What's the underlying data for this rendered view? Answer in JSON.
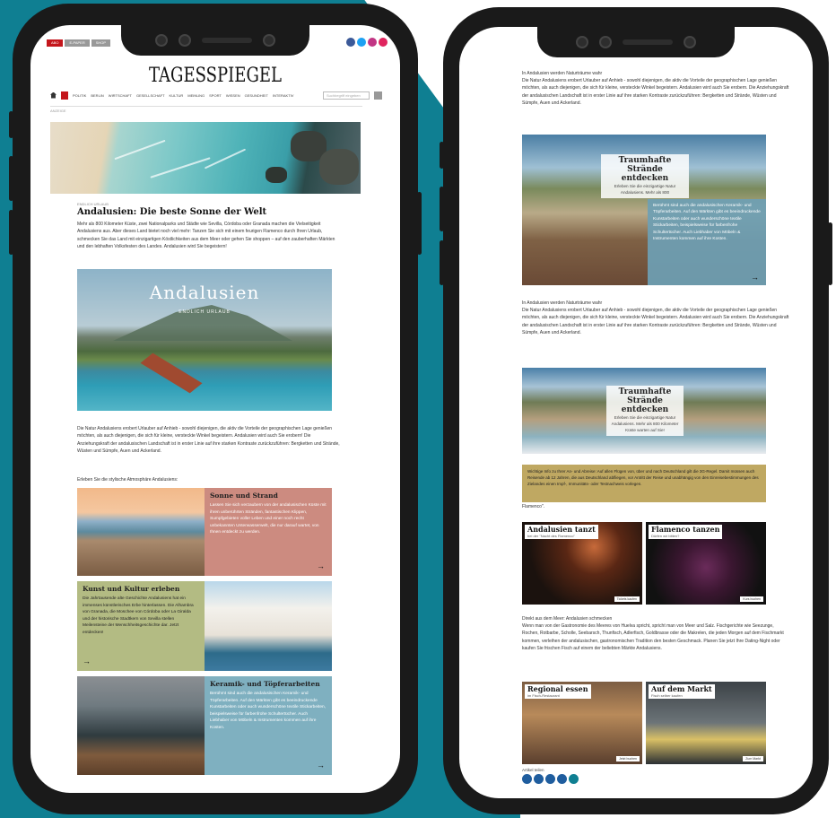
{
  "colors": {
    "teal": "#0f7f92",
    "red": "#c4161c",
    "card_rose": "#cc8b80",
    "card_olive": "#b3bb83",
    "card_blue": "#7fb0c0",
    "olive_box": "#bfa862",
    "phone_frame": "#1a1a1a"
  },
  "phone1": {
    "masthead": "TAGESSPIEGEL",
    "nav_items": [
      "POLITIK",
      "BERLIN",
      "WIRTSCHAFT",
      "GESELLSCHAFT",
      "KULTUR",
      "MEINUNG",
      "SPORT",
      "WISSEN",
      "GESUNDHEIT",
      "INTERAKTIV"
    ],
    "search_placeholder": "Suchbegriff eingeben",
    "breadcrumb": "ANZEIGE",
    "kicker": "ENDLICH URLAUB",
    "headline": "Andalusien: Die beste Sonne der Welt",
    "intro": "Mehr als 800 Kilometer Küste, zwei Nationalparks und Städte wie Sevilla, Córdoba oder Granada machen die Vielseitigkeit Andalusiens aus. Aber dieses Land bietet noch viel mehr: Tanzen Sie sich mit einem feurigen Flamenco durch Ihren Urlaub, schmecken Sie das Land mit einzigartigen Köstlichkeiten aus dem Meer oder gehen Sie shoppen – auf den zauberhaften Märkten und den lebhaften Volksfesten des Landes. Andalusien wird Sie begeistern!",
    "hero_title": "Andalusien",
    "hero_subtitle": "ENDLICH URLAUB",
    "body": "Die Natur Andalusiens erobert Urlauber auf Anhieb - sowohl diejenigen, die aktiv die Vorteile der geographischen Lage genießen möchten, als auch diejenigen, die sich für kleine, versteckte Winkel begeistern. Andalusien wird auch Sie erobern! Die Anziehungskraft der andalusischen Landschaft ist in erster Linie auf ihre starken Kontraste zurückzuführen: Bergketten und Strände, Wüsten und Sümpfe, Auen und Ackerland.",
    "lead_in": "Erleben Sie die stylische Atmosphäre Andalusiens:",
    "cards": [
      {
        "title": "Sonne und Strand",
        "text": "Lassen Sie sich verzaubern von der andalusischen Küste mit ihren unberührten Stränden, fantastischen Klippen, Sumpfgebieten voller Leben und einer noch recht unbekannten Unterwasserwelt, die nur darauf wartet, von Ihnen entdeckt zu werden.",
        "arrow": "→"
      },
      {
        "title": "Kunst und Kultur erleben",
        "text": "Die Jahrtausende alte Geschichte Andalusiens hat ein immenses künstlerisches Erbe hinterlassen. Die Alhambra von Granada, die Moschee von Córdoba oder La Giralda und der historische Stadtkern von Sevilla stellen Meilensteine der Menschheitsgeschichte dar. Jetzt entdecken!",
        "arrow": "→"
      },
      {
        "title": "Keramik- und Töpferarbeiten",
        "text": "Berühmt sind auch die andalusischen Keramik- und Töpferarbeiten. Auf den Märkten gibt es beeindruckende Kunstarbeiten oder auch wunderschöne textile Stickarbeiten, beispielsweise für farbenfrohe Schultertücher. Auch Liebhaber von Möbeln & Instrumenten kommen auf ihre Kosten.",
        "arrow": "→"
      }
    ]
  },
  "phone2": {
    "para_a_title": "In Andalusien werden Naturträume wahr",
    "para_a": "Die Natur Andalusiens erobert Urlauber auf Anhieb - sowohl diejenigen, die aktiv die Vorteile der geographischen Lage genießen möchten, als auch diejenigen, die sich für kleine, versteckte Winkel begeistern. Andalusien wird auch Sie erobern. Die Anziehungskraft der andalusischen Landschaft ist in erster Linie auf ihre starken Kontraste zurückzuführen: Bergketten und Strände, Wüsten und Sümpfe, Auen und Ackerland.",
    "card1_title": "Traumhafte Strände entdecken",
    "card1_sub": "Erleben Sie die einzigartige Natur Andalusiens. Mehr als 800",
    "card1_box": "Berühmt sind auch die andalusischen Keramik- und Töpferarbeiten. Auf den Märkten gibt es beeindruckende Kunstarbeiten oder auch wunderschöne textile Stickarbeiten, beispielsweise für farbenfrohe Schultertücher. Auch Liebhaber von Möbeln & Instrumenten kommen auf ihre Kosten.",
    "card1_arrow": "→",
    "para_b_title": "In Andalusien werden Naturträume wahr",
    "para_b": "Die Natur Andalusiens erobert Urlauber auf Anhieb - sowohl diejenigen, die aktiv die Vorteile der geographischen Lage genießen möchten, als auch diejenigen, die sich für kleine, versteckte Winkel begeistern. Andalusien wird auch Sie erobern. Die Anziehungskraft der andalusischen Landschaft ist in erster Linie auf ihre starken Kontraste zurückzuführen: Bergketten und Strände, Wüsten und Sümpfe, Auen und Ackerland.",
    "card2_title": "Traumhafte Strände entdecken",
    "card2_sub": "Erleben Sie die einzigartige Natur Andalusiens. Mehr als 800 Kilometer Küste warten auf Sie!",
    "notice": "Wichtige Info zu Ihrer An- und Abreise: Auf allen Flügen von, über und nach Deutschland gilt die 3G-Regel. Damit müssen auch Reisende ab 12 Jahren, die aus Deutschland abfliegen, vor Antritt der Reise und unabhängig von den Einreisebestimmungen des Zielandes einen Impf-, Immunitäts- oder Testnachweis vorlegen.",
    "notice_tail": "Flamenco\".",
    "tiles1": [
      {
        "title": "Andalusien tanzt",
        "sub": "bei der \"Nacht des Flamenco\"",
        "btn": "Tickets kaufen"
      },
      {
        "title": "Flamenco tanzen",
        "sub": "Dürfen wir bitten?",
        "btn": "Kurs buchen"
      }
    ],
    "para_c_title": "Direkt aus dem Meer: Andalusien schmecken",
    "para_c": "Wenn man von der Gastronomie des Meeres von Huelva spricht, spricht man von Meer und Salz. Fischgerichte wie Seezunge, Rochen, Rotbarbe, Scholle, Seebarsch, Thunfisch, Adlerfisch, Goldbrasse oder die Makrelen, die jeden Morgen auf dem Fischmarkt kommen, verleihen der andalusischen, gastronomischen Tradition den besten Geschmack. Planen Sie jetzt Ihre Dating-Night oder kaufen Sie frischen Fisch auf einem der beliebten Märkte Andalusiens.",
    "tiles2": [
      {
        "title": "Regional essen",
        "sub": "im Fisch-Restaurant",
        "btn": "Jetzt buchen"
      },
      {
        "title": "Auf dem Markt",
        "sub": "Fisch selber kaufen",
        "btn": "Zum Markt"
      }
    ],
    "share_label": "Artikel teilen"
  }
}
